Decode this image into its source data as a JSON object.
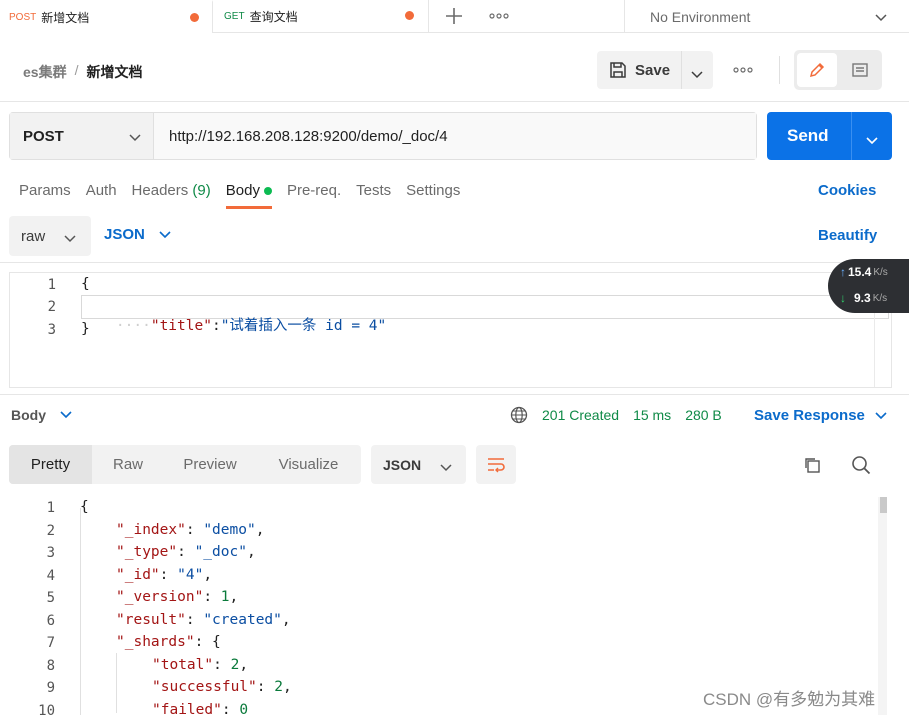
{
  "tabs": [
    {
      "method": "POST",
      "title": "新增文档"
    },
    {
      "method": "GET",
      "title": "查询文档"
    }
  ],
  "environment": "No Environment",
  "breadcrumb": {
    "parent": "es集群",
    "separator": "/",
    "current": "新增文档"
  },
  "save_label": "Save",
  "request": {
    "method": "POST",
    "url": "http://192.168.208.128:9200/demo/_doc/4",
    "send_label": "Send"
  },
  "request_tabs": {
    "params": "Params",
    "auth": "Auth",
    "headers": "Headers",
    "headers_count": "(9)",
    "body": "Body",
    "prereq": "Pre-req.",
    "tests": "Tests",
    "settings": "Settings",
    "cookies": "Cookies"
  },
  "body_mode": "raw",
  "body_language": "JSON",
  "beautify_label": "Beautify",
  "request_body": {
    "line_numbers": [
      "1",
      "2",
      "3"
    ],
    "open_brace": "{",
    "key": "\"title\"",
    "colon": ":",
    "value": "\"试着插入一条 id = 4\"",
    "close_brace": "}"
  },
  "network_speed": {
    "up": "15.4",
    "down": "9.3",
    "unit": "K/s"
  },
  "response": {
    "body_label": "Body",
    "status": "201 Created",
    "time": "15 ms",
    "size": "280 B",
    "save_response": "Save Response",
    "view_tabs": [
      "Pretty",
      "Raw",
      "Preview",
      "Visualize"
    ],
    "format": "JSON",
    "line_numbers": [
      "1",
      "2",
      "3",
      "4",
      "5",
      "6",
      "7",
      "8",
      "9",
      "10"
    ],
    "lines": [
      {
        "key": "",
        "value": "{",
        "type": "punc"
      },
      {
        "key": "\"_index\"",
        "value": "\"demo\"",
        "type": "str"
      },
      {
        "key": "\"_type\"",
        "value": "\"_doc\"",
        "type": "str"
      },
      {
        "key": "\"_id\"",
        "value": "\"4\"",
        "type": "str"
      },
      {
        "key": "\"_version\"",
        "value": "1",
        "type": "num"
      },
      {
        "key": "\"result\"",
        "value": "\"created\"",
        "type": "str"
      },
      {
        "key": "\"_shards\"",
        "value": "{",
        "type": "obj"
      },
      {
        "key": "\"total\"",
        "value": "2",
        "type": "num"
      },
      {
        "key": "\"successful\"",
        "value": "2",
        "type": "num"
      },
      {
        "key": "\"failed\"",
        "value": "0",
        "type": "num"
      }
    ]
  },
  "watermark": "CSDN @有多勉为其难",
  "colors": {
    "post": "#f26b3a",
    "get": "#0f8a47",
    "send": "#0b72e7",
    "link": "#0b6bcb",
    "status_ok": "#0f8a47"
  }
}
